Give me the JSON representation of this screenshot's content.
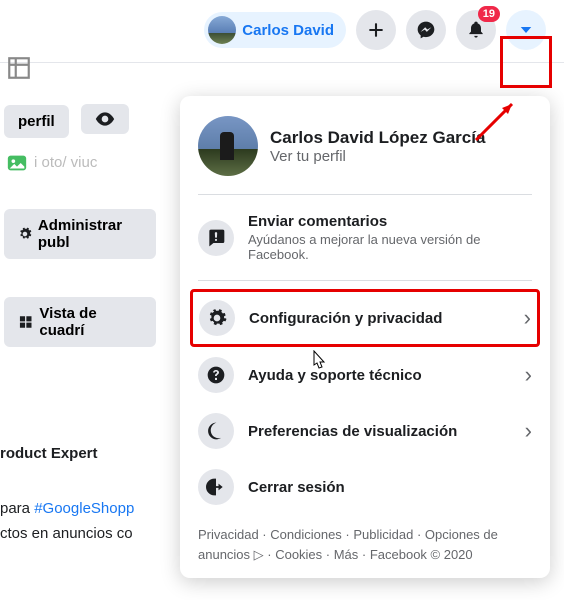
{
  "header": {
    "user_name": "Carlos David",
    "notification_count": "19"
  },
  "left_partial": {
    "btn1": "perfil",
    "btn_admin": "Administrar publ",
    "btn_grid": "Vista de cuadrí",
    "foto_text": "i oto/ viuc",
    "expert_text": "roduct Expert",
    "shopping_prefix": "para ",
    "shopping_link": "#GoogleShopp",
    "shopping_line2": "ctos en anuncios co"
  },
  "dropdown": {
    "profile": {
      "name": "Carlos David López García",
      "sub": "Ver tu perfil"
    },
    "feedback": {
      "title": "Enviar comentarios",
      "sub": "Ayúdanos a mejorar la nueva versión de Facebook."
    },
    "items": [
      {
        "label": "Configuración y privacidad"
      },
      {
        "label": "Ayuda y soporte técnico"
      },
      {
        "label": "Preferencias de visualización"
      },
      {
        "label": "Cerrar sesión"
      }
    ],
    "footer": "Privacidad · Condiciones · Publicidad · Opciones de anuncios ▷ · Cookies · Más · Facebook © 2020"
  }
}
